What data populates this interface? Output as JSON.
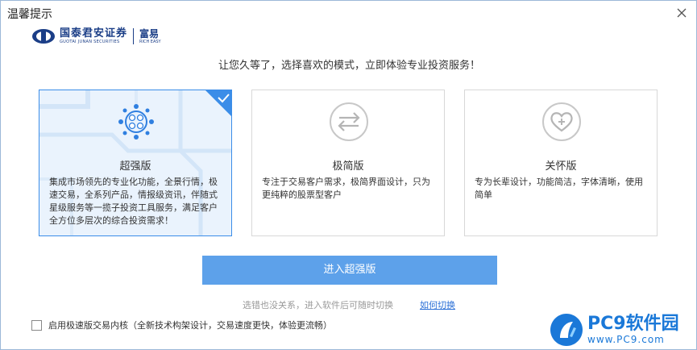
{
  "window": {
    "title": "温馨提示",
    "close_icon": "close-icon"
  },
  "logo": {
    "name_cn": "国泰君安证券",
    "name_en": "GUOTAI JUNAN SECURITIES",
    "product_cn": "富易",
    "product_en": "RICH EASY",
    "brand_color": "#1b3e87"
  },
  "headline": "让您久等了，选择喜欢的模式，立即体验专业投资服务！",
  "modes": [
    {
      "name": "超强版",
      "description": "集成市场领先的专业化功能，全景行情，极速交易，全系列产品，情报级资讯，伴随式星级服务等一揽子投资工具服务，满足客户全方位多层次的综合投资需求！",
      "icon": "network-icon",
      "selected": true
    },
    {
      "name": "极简版",
      "description": "专注于交易客户需求，极简界面设计，只为更纯粹的股票型客户",
      "icon": "swap-arrows-icon",
      "selected": false
    },
    {
      "name": "关怀版",
      "description": "专为长辈设计，功能简洁，字体清晰，使用简单",
      "icon": "heart-plus-icon",
      "selected": false
    }
  ],
  "enter_button": "进入超强版",
  "hint": "选错也没关系，进入软件后可随时切换",
  "hint_link": "如何切换",
  "checkbox": {
    "label": "启用极速版交易内核（全新技术构架设计，交易速度更快，体验更流畅）",
    "checked": false
  },
  "watermark": {
    "title": "PC9软件园",
    "url": "www.PC9.com"
  },
  "colors": {
    "accent": "#3b8de8",
    "button": "#5da1ea",
    "link": "#2a6fd6"
  }
}
